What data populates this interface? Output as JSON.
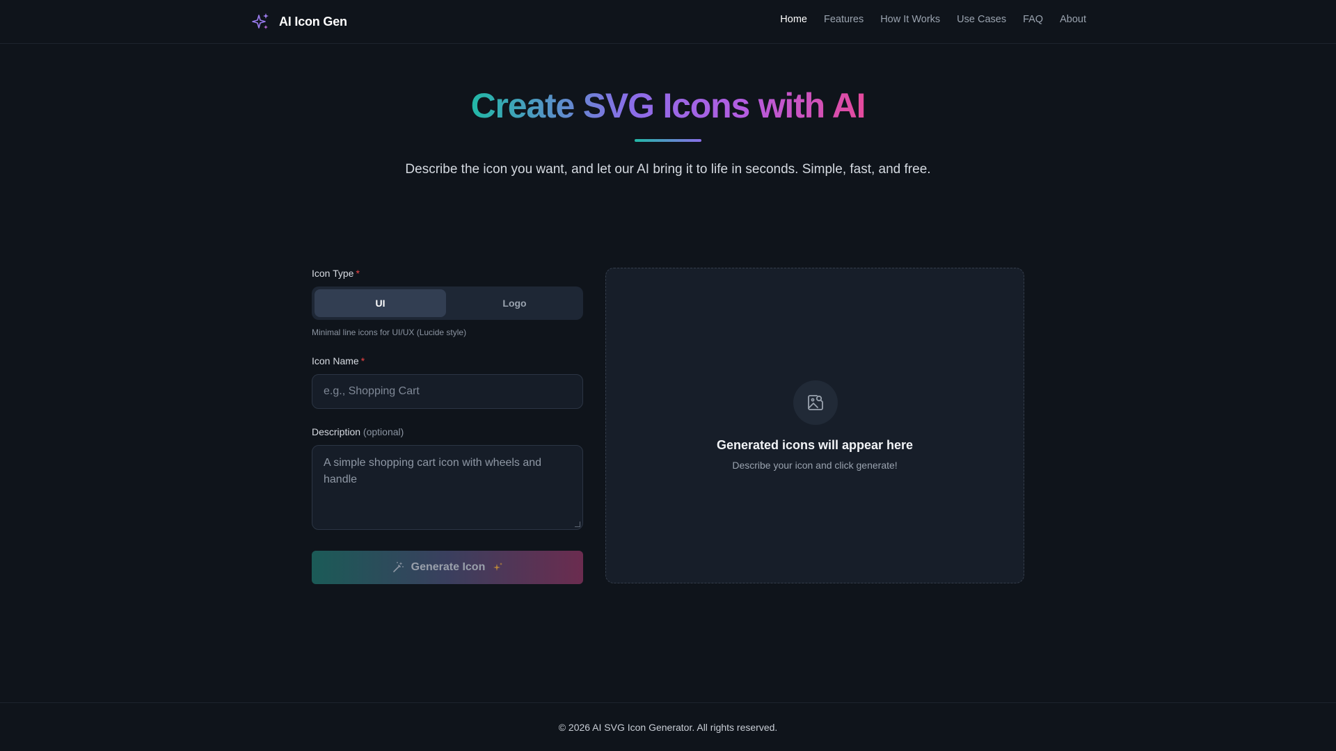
{
  "header": {
    "brand_name": "AI Icon Gen",
    "nav": [
      "Home",
      "Features",
      "How It Works",
      "Use Cases",
      "FAQ",
      "About"
    ],
    "active_nav": "Home"
  },
  "hero": {
    "title": "Create SVG Icons with AI",
    "subtitle": "Describe the icon you want, and let our AI bring it to life in seconds. Simple, fast, and free."
  },
  "form": {
    "icon_type_label": "Icon Type",
    "required_mark": "*",
    "type_options": [
      "UI",
      "Logo"
    ],
    "selected_type": "UI",
    "type_hint": "Minimal line icons for UI/UX (Lucide style)",
    "icon_name_label": "Icon Name",
    "icon_name_placeholder": "e.g., Shopping Cart",
    "description_label": "Description",
    "description_optional": "(optional)",
    "description_placeholder": "A simple shopping cart icon with wheels and handle",
    "generate_label": "Generate Icon"
  },
  "preview": {
    "title": "Generated icons will appear here",
    "subtitle": "Describe your icon and click generate!"
  },
  "footer": {
    "copyright": "© 2026 AI SVG Icon Generator. All rights reserved."
  },
  "icons": {
    "brand": "sparkles-icon",
    "generate_left": "wand-icon",
    "generate_right": "sparkle-icon",
    "preview": "image-search-icon"
  },
  "colors": {
    "background": "#0f141b",
    "gradient_start": "#22b8a6",
    "gradient_mid": "#8a6ee8",
    "gradient_end": "#e44a9c",
    "required": "#ef4444"
  }
}
